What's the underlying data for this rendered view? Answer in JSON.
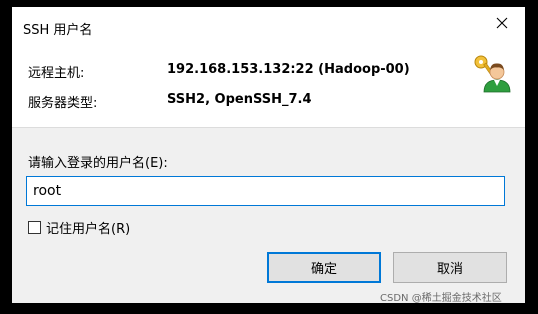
{
  "window": {
    "title": "SSH 用户名"
  },
  "info": {
    "host_label": "远程主机:",
    "host_value": "192.168.153.132:22 (Hadoop-00)",
    "server_type_label": "服务器类型:",
    "server_type_value": "SSH2, OpenSSH_7.4"
  },
  "prompt": {
    "label": "请输入登录的用户名(E):",
    "username_value": "root"
  },
  "remember": {
    "label": "记住用户名(R)",
    "checked": false
  },
  "buttons": {
    "ok_label": "确定",
    "cancel_label": "取消"
  },
  "watermark": {
    "text": "CSDN @稀土掘金技术社区"
  },
  "icons": {
    "close": "close-icon",
    "user_key": "user-key-icon"
  },
  "colors": {
    "accent": "#0078d7",
    "dialog_bg": "#f0f0f0",
    "panel_bg": "#ffffff"
  }
}
